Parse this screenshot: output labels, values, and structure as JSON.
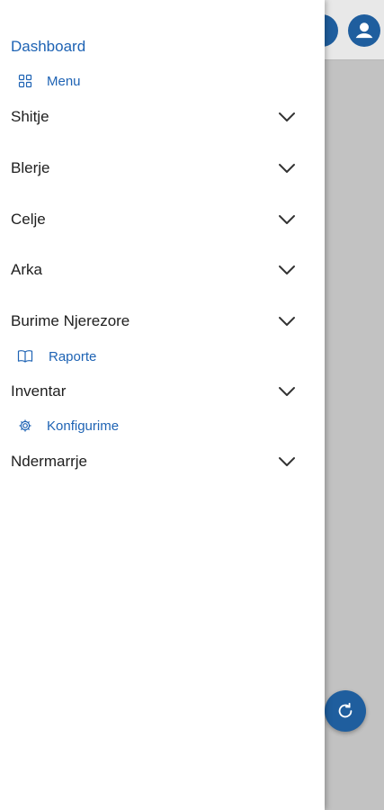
{
  "drawer": {
    "dashboard": "Dashboard",
    "menu": "Menu",
    "sections": [
      {
        "label": "Shitje"
      },
      {
        "label": "Blerje"
      },
      {
        "label": "Celje"
      },
      {
        "label": "Arka"
      },
      {
        "label": "Burime Njerezore"
      }
    ],
    "raporte": "Raporte",
    "inventar": "Inventar",
    "konfigurime": "Konfigurime",
    "ndermarrje": "Ndermarrje"
  },
  "colors": {
    "link": "#1e63b4",
    "accent": "#1f5e9e",
    "scrim": "#c2c2c2"
  },
  "icons": {
    "menu": "grid-icon",
    "raporte": "book-icon",
    "konfigurime": "gear-icon",
    "chevron": "chevron-down-icon",
    "fab": "refresh-icon",
    "profile": "account-circle-icon"
  }
}
